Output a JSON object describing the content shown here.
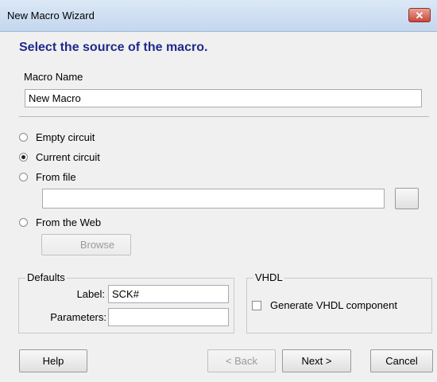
{
  "window": {
    "title": "New Macro Wizard",
    "close_glyph": "✕"
  },
  "heading": "Select the source of the macro.",
  "macro_name": {
    "label": "Macro Name",
    "value": "New Macro"
  },
  "source_options": [
    {
      "label": "Empty circuit",
      "checked": false
    },
    {
      "label": "Current circuit",
      "checked": true
    },
    {
      "label": "From file",
      "checked": false
    },
    {
      "label": "From the Web",
      "checked": false
    }
  ],
  "from_file": {
    "value": "",
    "browse_label": ""
  },
  "web": {
    "browse_label": "Browse"
  },
  "defaults": {
    "legend": "Defaults",
    "label_caption": "Label:",
    "label_value": "SCK#",
    "parameters_caption": "Parameters:",
    "parameters_value": ""
  },
  "vhdl": {
    "legend": "VHDL",
    "generate_label": "Generate VHDL component",
    "checked": false
  },
  "buttons": {
    "help": "Help",
    "back": "< Back",
    "next": "Next >",
    "cancel": "Cancel"
  },
  "colors": {
    "heading": "#1f2a8c",
    "close_button": "#c9473a"
  }
}
